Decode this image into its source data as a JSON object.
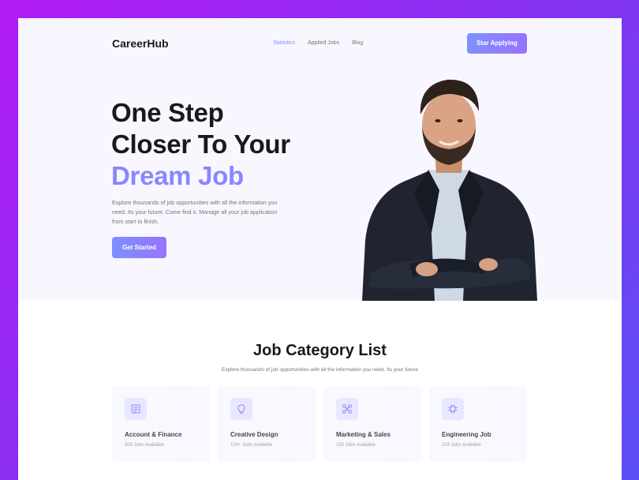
{
  "nav": {
    "logo": "CareerHub",
    "links": [
      {
        "label": "Statistics",
        "active": true
      },
      {
        "label": "Applied Jobs",
        "active": false
      },
      {
        "label": "Blog",
        "active": false
      }
    ],
    "cta_label": "Star Applying"
  },
  "hero": {
    "title_line1": "One Step",
    "title_line2": "Closer To Your",
    "title_accent": "Dream Job",
    "description": "Explore thousands of job opportunities with all the information you need. Its your future. Come find it. Manage all your job application from start to finish.",
    "button_label": "Get Started"
  },
  "categories": {
    "title": "Job Category List",
    "subtitle": "Explore thousands of job opportunities with all the information you need. Its your future",
    "items": [
      {
        "name": "Account & Finance",
        "count": "300 Jobs Available",
        "icon": "ledger-icon"
      },
      {
        "name": "Creative Design",
        "count": "100+ Jobs Available",
        "icon": "lightbulb-icon"
      },
      {
        "name": "Marketing & Sales",
        "count": "150 Jobs Available",
        "icon": "network-icon"
      },
      {
        "name": "Engineering Job",
        "count": "224 Jobs Available",
        "icon": "chip-icon"
      }
    ]
  },
  "colors": {
    "accent": "#7e90fe",
    "accent_end": "#9873ff",
    "frame_gradient": [
      "#b21bf5",
      "#5b4ff5"
    ]
  }
}
